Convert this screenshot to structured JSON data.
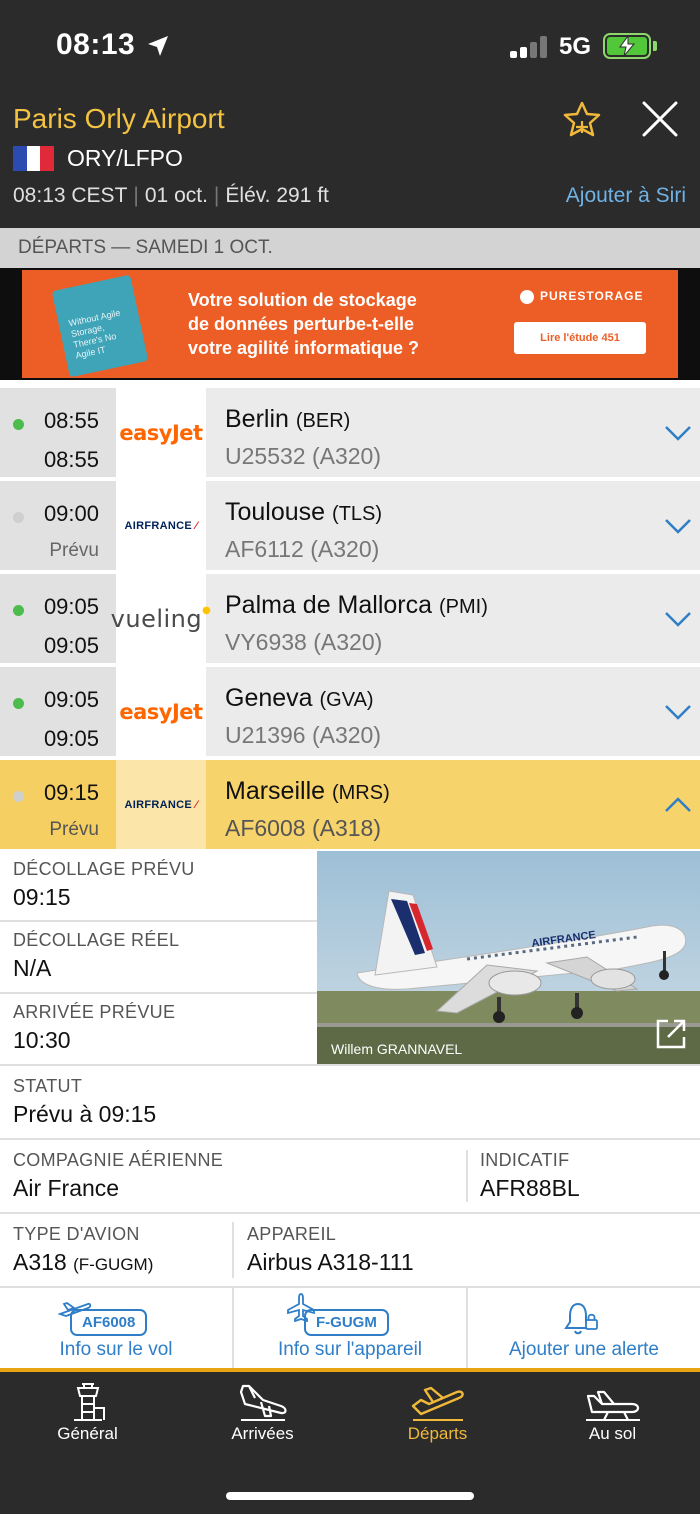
{
  "status_bar": {
    "time": "08:13",
    "network": "5G"
  },
  "airport": {
    "name": "Paris Orly Airport",
    "code": "ORY/LFPO",
    "local_time": "08:13 CEST",
    "date": "01 oct.",
    "elevation": "Élév. 291 ft",
    "siri_label": "Ajouter à Siri"
  },
  "section_title": "DÉPARTS — SAMEDI 1 OCT.",
  "ad": {
    "line1": "Votre solution de stockage",
    "line2": "de données perturbe-t-elle",
    "line3": "votre agilité informatique ?",
    "brand": "PURESTORAGE",
    "cta": "Lire l'étude 451",
    "card_text": "Without Agile Storage, There's No Agile IT"
  },
  "flights": [
    {
      "sched": "08:55",
      "est": "08:55",
      "status_dot": "green",
      "airline": "easyJet",
      "destination": "Berlin",
      "dest_code": "(BER)",
      "flight": "U25532 (A320)"
    },
    {
      "sched": "09:00",
      "est": "Prévu",
      "status_dot": "grey",
      "airline": "AIRFRANCE",
      "destination": "Toulouse",
      "dest_code": "(TLS)",
      "flight": "AF6112 (A320)"
    },
    {
      "sched": "09:05",
      "est": "09:05",
      "status_dot": "green",
      "airline": "vueling",
      "destination": "Palma de Mallorca",
      "dest_code": "(PMI)",
      "flight": "VY6938 (A320)"
    },
    {
      "sched": "09:05",
      "est": "09:05",
      "status_dot": "green",
      "airline": "easyJet",
      "destination": "Geneva",
      "dest_code": "(GVA)",
      "flight": "U21396 (A320)"
    },
    {
      "sched": "09:15",
      "est": "Prévu",
      "status_dot": "grey",
      "airline": "AIRFRANCE",
      "destination": "Marseille",
      "dest_code": "(MRS)",
      "flight": "AF6008 (A318)"
    }
  ],
  "details": {
    "sched_takeoff_label": "DÉCOLLAGE PRÉVU",
    "sched_takeoff": "09:15",
    "actual_takeoff_label": "DÉCOLLAGE RÉEL",
    "actual_takeoff": "N/A",
    "sched_arrival_label": "ARRIVÉE PRÉVUE",
    "sched_arrival": "10:30",
    "status_label": "STATUT",
    "status": "Prévu à 09:15",
    "airline_label": "COMPAGNIE AÉRIENNE",
    "airline": "Air France",
    "callsign_label": "INDICATIF",
    "callsign": "AFR88BL",
    "aircraft_type_label": "TYPE D'AVION",
    "aircraft_type": "A318",
    "registration": "(F-GUGM)",
    "aircraft_label": "APPAREIL",
    "aircraft": "Airbus A318-111",
    "photo_credit": "Willem GRANNAVEL",
    "photo_livery": "AIRFRANCE"
  },
  "actions": [
    {
      "badge": "AF6008",
      "label": "Info sur le vol"
    },
    {
      "badge": "F-GUGM",
      "label": "Info sur l'appareil"
    },
    {
      "badge": "",
      "label": "Ajouter une alerte"
    }
  ],
  "tabs": [
    {
      "label": "Général"
    },
    {
      "label": "Arrivées"
    },
    {
      "label": "Départs"
    },
    {
      "label": "Au sol"
    }
  ],
  "colors": {
    "accent": "#f0b93a",
    "header_bg": "#2b2b2b",
    "link": "#2f7ec7",
    "selected_row": "#f7d36c",
    "status_green": "#4cbc4c"
  }
}
